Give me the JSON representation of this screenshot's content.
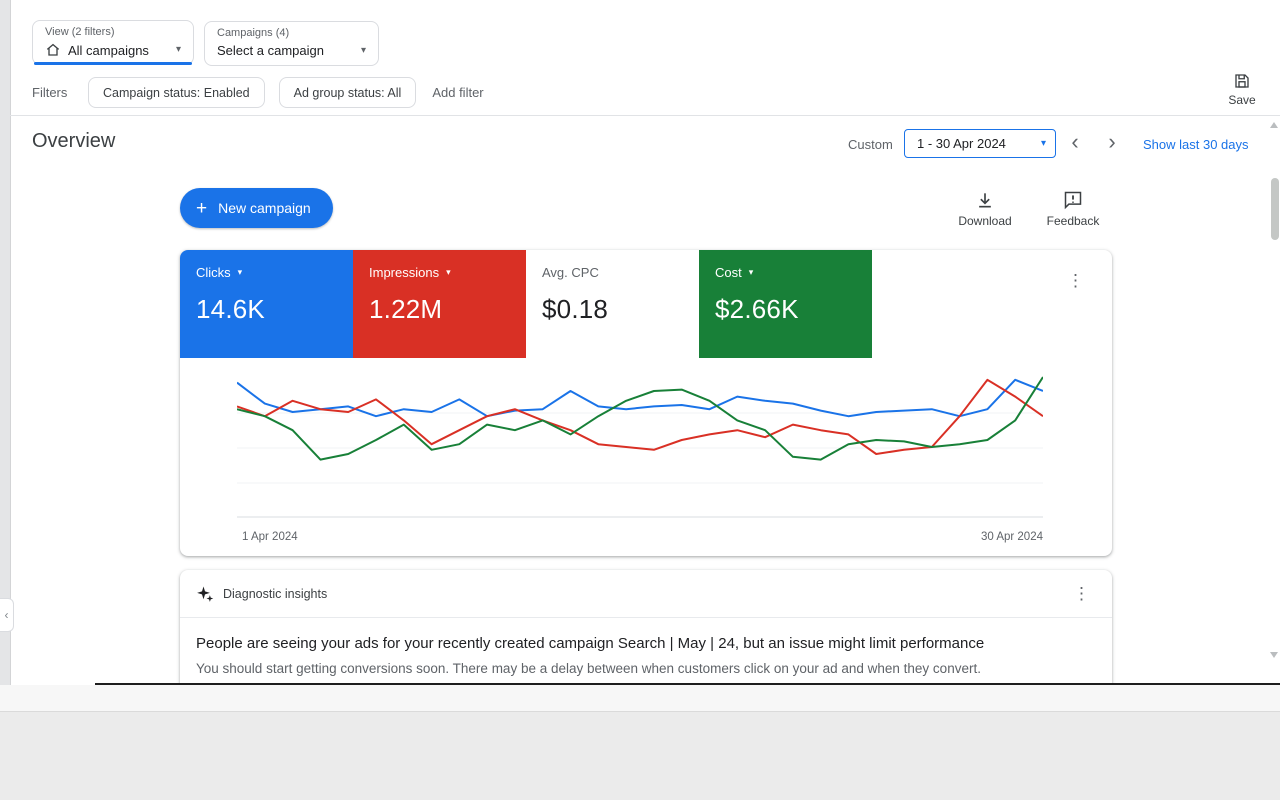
{
  "colors": {
    "accent_blue": "#1a73e8",
    "tile_red": "#d93025",
    "tile_green": "#188038",
    "text_dark": "#202124",
    "text_gray": "#5f6368"
  },
  "icons": {
    "caret": "▾",
    "dots": "⋮",
    "chevron_left": "‹",
    "chevron_right": "›",
    "plus": "+"
  },
  "topbar": {
    "view_selector": {
      "label": "View (2 filters)",
      "value": "All campaigns"
    },
    "campaign_selector": {
      "label": "Campaigns (4)",
      "value": "Select a campaign"
    }
  },
  "filters_bar": {
    "label": "Filters",
    "chips": [
      {
        "text": "Campaign status: Enabled"
      },
      {
        "text": "Ad group status: All"
      }
    ],
    "add_filter": "Add filter",
    "save_label": "Save"
  },
  "header": {
    "title": "Overview",
    "custom_label": "Custom",
    "date_range": "1 - 30 Apr 2024",
    "show_last_label": "Show last 30 days"
  },
  "actions": {
    "new_campaign_label": "New campaign",
    "download_label": "Download",
    "feedback_label": "Feedback"
  },
  "metrics": [
    {
      "label": "Clicks",
      "value": "14.6K",
      "bg": "#1a73e8",
      "label_fg": "#ffffff",
      "value_fg": "#ffffff",
      "has_caret": true
    },
    {
      "label": "Impressions",
      "value": "1.22M",
      "bg": "#d93025",
      "label_fg": "#ffffff",
      "value_fg": "#ffffff",
      "has_caret": true
    },
    {
      "label": "Avg. CPC",
      "value": "$0.18",
      "bg": "#ffffff",
      "label_fg": "#5f6368",
      "value_fg": "#202124",
      "has_caret": false
    },
    {
      "label": "Cost",
      "value": "$2.66K",
      "bg": "#188038",
      "label_fg": "#ffffff",
      "value_fg": "#ffffff",
      "has_caret": true
    }
  ],
  "chart_data": {
    "type": "line",
    "title": "",
    "x_axis": {
      "start_label": "1 Apr 2024",
      "end_label": "30 Apr 2024",
      "points": 30
    },
    "y_axis": {
      "labels_visible": false,
      "scale": "relative 0-100, estimated from pixels"
    },
    "legend_position": "none",
    "grid": true,
    "series": [
      {
        "name": "Clicks",
        "color": "#1a73e8",
        "values": [
          96,
          81,
          75,
          77,
          79,
          72,
          77,
          75,
          84,
          72,
          76,
          77,
          90,
          79,
          77,
          79,
          80,
          77,
          86,
          83,
          81,
          76,
          72,
          75,
          76,
          77,
          72,
          77,
          98,
          90
        ]
      },
      {
        "name": "Impressions",
        "color": "#d93025",
        "values": [
          79,
          72,
          83,
          77,
          75,
          84,
          69,
          52,
          62,
          72,
          77,
          69,
          62,
          52,
          50,
          48,
          55,
          59,
          62,
          57,
          66,
          62,
          59,
          45,
          48,
          50,
          72,
          98,
          86,
          72
        ]
      },
      {
        "name": "Cost",
        "color": "#188038",
        "values": [
          77,
          72,
          62,
          41,
          45,
          55,
          66,
          48,
          52,
          66,
          62,
          69,
          59,
          72,
          83,
          90,
          91,
          83,
          69,
          62,
          43,
          41,
          52,
          55,
          54,
          50,
          52,
          55,
          69,
          100
        ]
      }
    ]
  },
  "insights": {
    "title": "Diagnostic insights",
    "headline": "People are seeing your ads for your recently created campaign Search | May | 24, but an issue might limit performance",
    "body": "You should start getting conversions soon. There may be a delay between when customers click on your ad and when they convert."
  }
}
